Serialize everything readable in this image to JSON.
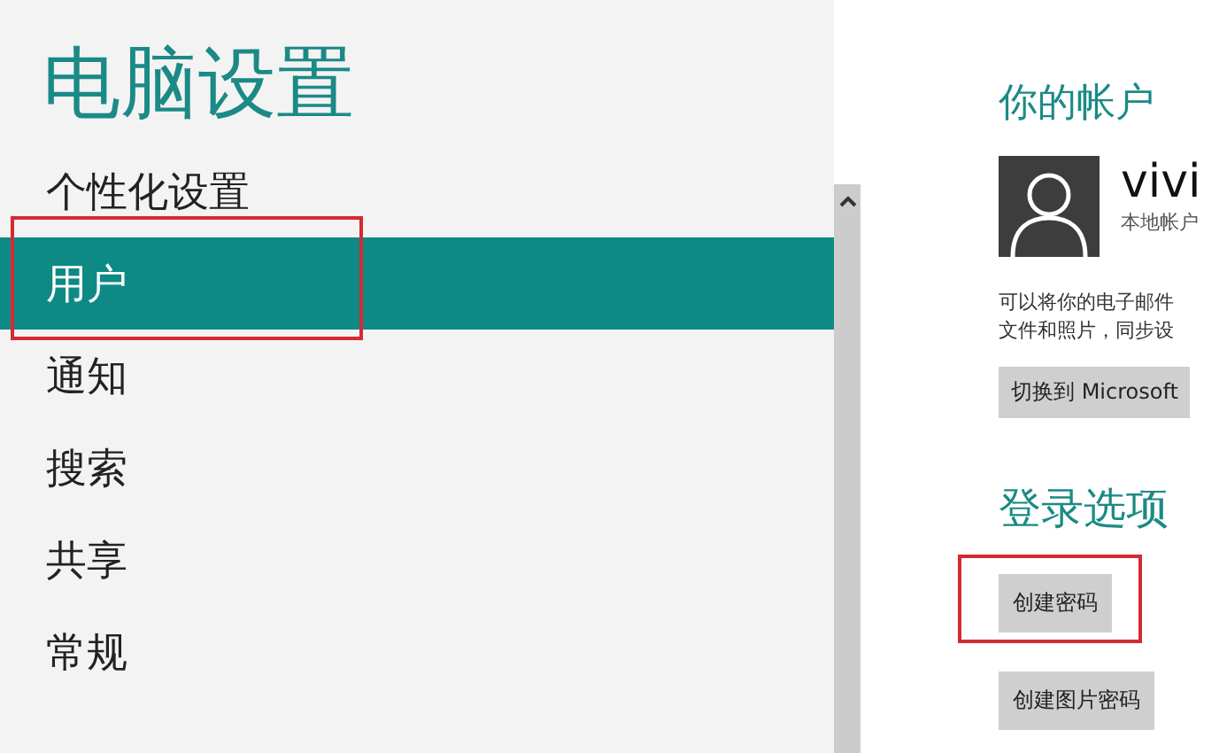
{
  "title": "电脑设置",
  "sidebar": {
    "items": [
      {
        "label": "个性化设置",
        "selected": false,
        "highlighted": false
      },
      {
        "label": "用户",
        "selected": true,
        "highlighted": true
      },
      {
        "label": "通知",
        "selected": false,
        "highlighted": false
      },
      {
        "label": "搜索",
        "selected": false,
        "highlighted": false
      },
      {
        "label": "共享",
        "selected": false,
        "highlighted": false
      },
      {
        "label": "常规",
        "selected": false,
        "highlighted": false
      }
    ]
  },
  "account": {
    "heading": "你的帐户",
    "name": "vivi",
    "type": "本地帐户",
    "description": [
      "可以将你的电子邮件",
      "文件和照片，同步设"
    ],
    "switch_button": "切换到 Microsoft"
  },
  "sign_in": {
    "heading": "登录选项",
    "buttons": [
      {
        "label": "创建密码",
        "highlighted": true
      },
      {
        "label": "创建图片密码",
        "highlighted": false
      }
    ]
  }
}
